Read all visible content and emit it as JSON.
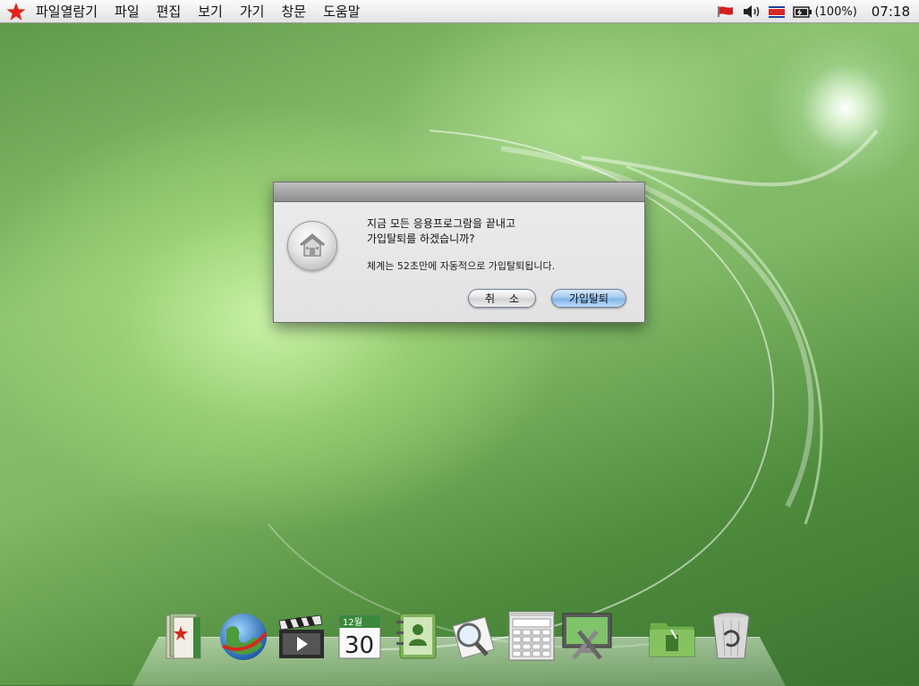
{
  "menubar": {
    "app_menu": "파일열람기",
    "items": [
      "파일",
      "편집",
      "보기",
      "가기",
      "창문",
      "도움말"
    ],
    "battery": "(100%)",
    "clock": "07:18"
  },
  "dialog": {
    "line1": "지금 모든 응용프로그람을 끝내고",
    "line2": "가입탈퇴를 하겠습니까?",
    "sub": "체계는 52초만에 자동적으로 가입탈퇴됩니다.",
    "cancel_label": "취 소",
    "logout_label": "가입탈퇴"
  },
  "dock": {
    "calendar_month": "12월",
    "calendar_day": "30",
    "icons": [
      "documents-icon",
      "globe-icon",
      "movie-clapper-icon",
      "calendar-icon",
      "address-book-icon",
      "document-viewer-icon",
      "calculator-icon",
      "system-settings-icon",
      "folder-icon",
      "trash-icon"
    ]
  },
  "colors": {
    "accent_red": "#e0231c",
    "button_blue": "#9ec7ef",
    "wallpaper_green": "#6aaa52"
  }
}
